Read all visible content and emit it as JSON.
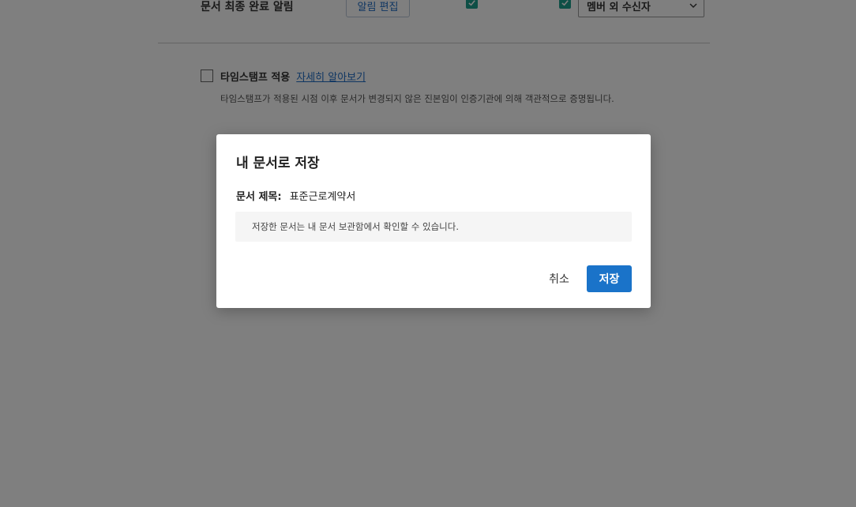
{
  "background": {
    "notify_label": "문서 최종 완료 알림",
    "notify_edit_button": "알림 편집",
    "recipient_select_value": "멤버 외 수신자",
    "timestamp_label": "타임스탬프 적용",
    "timestamp_link": "자세히 알아보기",
    "timestamp_description": "타임스탬프가 적용된 시점 이후 문서가 변경되지 않은 진본임이 인증기관에 의해 객관적으로 증명됩니다."
  },
  "dialog": {
    "title": "내 문서로 저장",
    "doc_title_key": "문서 제목:",
    "doc_title_value": "표준근로계약서",
    "info_text": "저장한 문서는 내 문서 보관함에서 확인할 수 있습니다.",
    "cancel_label": "취소",
    "save_label": "저장"
  },
  "colors": {
    "accent": "#1a73c9",
    "check_green": "#1d9f8c",
    "link": "#1f6cc5",
    "overlay": "rgba(0,0,0,0.5)"
  },
  "icons": {
    "check": "check-icon",
    "select_arrow": "chevron-down-icon"
  }
}
